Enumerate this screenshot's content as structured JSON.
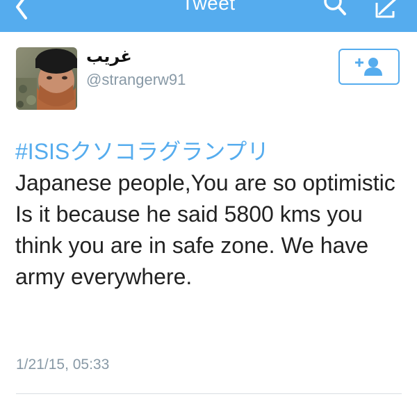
{
  "header": {
    "title": "Tweet",
    "back_icon": "chevron-left-icon",
    "search_icon": "search-icon",
    "compose_icon": "compose-icon",
    "bar_color": "#55acee"
  },
  "tweet": {
    "display_name": "غريب",
    "handle": "@strangerw91",
    "hashtag": "#ISISクソコラグランプリ",
    "body": "Japanese people,You are so optimistic Is it because he said 5800 kms you think you are in safe zone. We have army everywhere.",
    "timestamp": "1/21/15, 05:33"
  },
  "follow_button": {
    "icon": "add-user-icon",
    "accent_color": "#55acee"
  }
}
